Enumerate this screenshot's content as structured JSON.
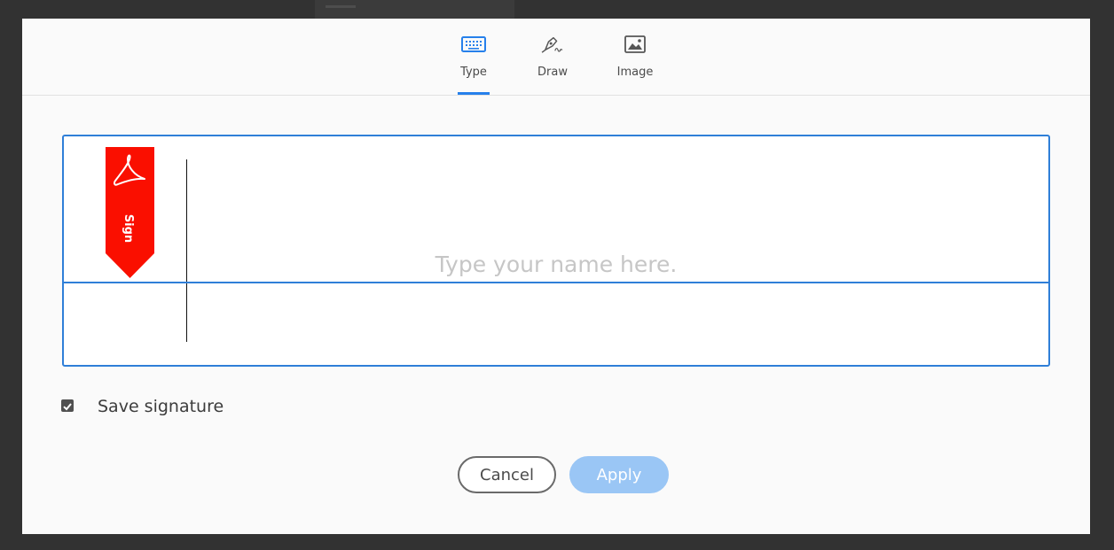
{
  "tabs": [
    {
      "id": "type",
      "label": "Type",
      "icon": "keyboard-icon",
      "active": true
    },
    {
      "id": "draw",
      "label": "Draw",
      "icon": "pen-draw-icon",
      "active": false
    },
    {
      "id": "image",
      "label": "Image",
      "icon": "image-icon",
      "active": false
    }
  ],
  "signature": {
    "placeholder": "Type your name here.",
    "value": "",
    "flag_label": "Sign"
  },
  "save_signature": {
    "label": "Save signature",
    "checked": true
  },
  "buttons": {
    "cancel_label": "Cancel",
    "apply_label": "Apply"
  },
  "colors": {
    "accent": "#2680eb",
    "sign_flag": "#fa0f00",
    "apply_disabled": "#9ac6f5"
  }
}
